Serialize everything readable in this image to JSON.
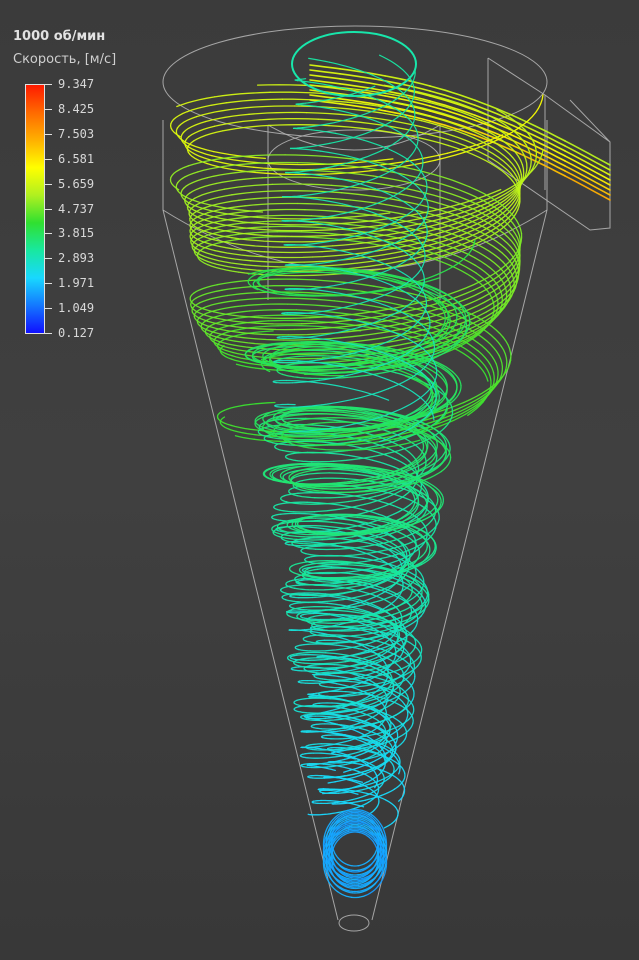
{
  "legend": {
    "title": "1000 об/мин",
    "subtitle": "Скорость, [м/с]",
    "ticks": [
      "9.347",
      "8.425",
      "7.503",
      "6.581",
      "5.659",
      "4.737",
      "3.815",
      "2.893",
      "1.971",
      "1.049",
      "0.127"
    ],
    "range": [
      0.127,
      9.347
    ],
    "colormap": [
      "#1010ff",
      "#1478ff",
      "#18d8ff",
      "#18e8a0",
      "#30e030",
      "#b0f020",
      "#ffff00",
      "#ffb000",
      "#ff6a00",
      "#ff1a00"
    ]
  },
  "scene": {
    "outline_color": "#b8b8b8",
    "visible_parts": [
      "cylindrical body",
      "conical section",
      "tangential inlet duct",
      "vortex finder tube",
      "bottom outlet"
    ],
    "streamlines": "helical particle paths colored by speed"
  }
}
